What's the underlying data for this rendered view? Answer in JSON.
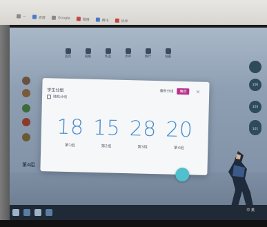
{
  "browser": {
    "bookmarks": [
      {
        "label": "—",
        "icon": "page-icon"
      },
      {
        "label": "百度",
        "icon": "baidu-icon"
      },
      {
        "label": "Google",
        "icon": "google-icon"
      },
      {
        "label": "微博",
        "icon": "weibo-icon"
      },
      {
        "label": "腾讯",
        "icon": "tencent-icon"
      },
      {
        "label": "优学",
        "icon": "page-icon"
      }
    ]
  },
  "app": {
    "nav": [
      {
        "label": "首页",
        "icon": "home-icon"
      },
      {
        "label": "班级",
        "icon": "class-icon"
      },
      {
        "label": "作业",
        "icon": "homework-icon"
      },
      {
        "label": "点评",
        "icon": "review-icon"
      },
      {
        "label": "统计",
        "icon": "stats-icon"
      },
      {
        "label": "设置",
        "icon": "gear-icon"
      }
    ],
    "section_heading": "第4组",
    "side_badges": [
      "100",
      "103",
      "106",
      "101"
    ]
  },
  "dialog": {
    "title": "学生分组",
    "subtitle": "随机分组",
    "action_link": "重新分组",
    "action_tag": "确定",
    "close_glyph": "×",
    "groups": [
      {
        "count": "18",
        "label": "第1组"
      },
      {
        "count": "15",
        "label": "第2组"
      },
      {
        "count": "28",
        "label": "第3组"
      },
      {
        "count": "20",
        "label": "第4组"
      }
    ]
  },
  "taskbar": {
    "right_text": "中 英"
  },
  "colors": {
    "number_blue": "#4a8fcf",
    "accent_magenta": "#b8318b",
    "fab_teal": "#4fc0cc"
  }
}
